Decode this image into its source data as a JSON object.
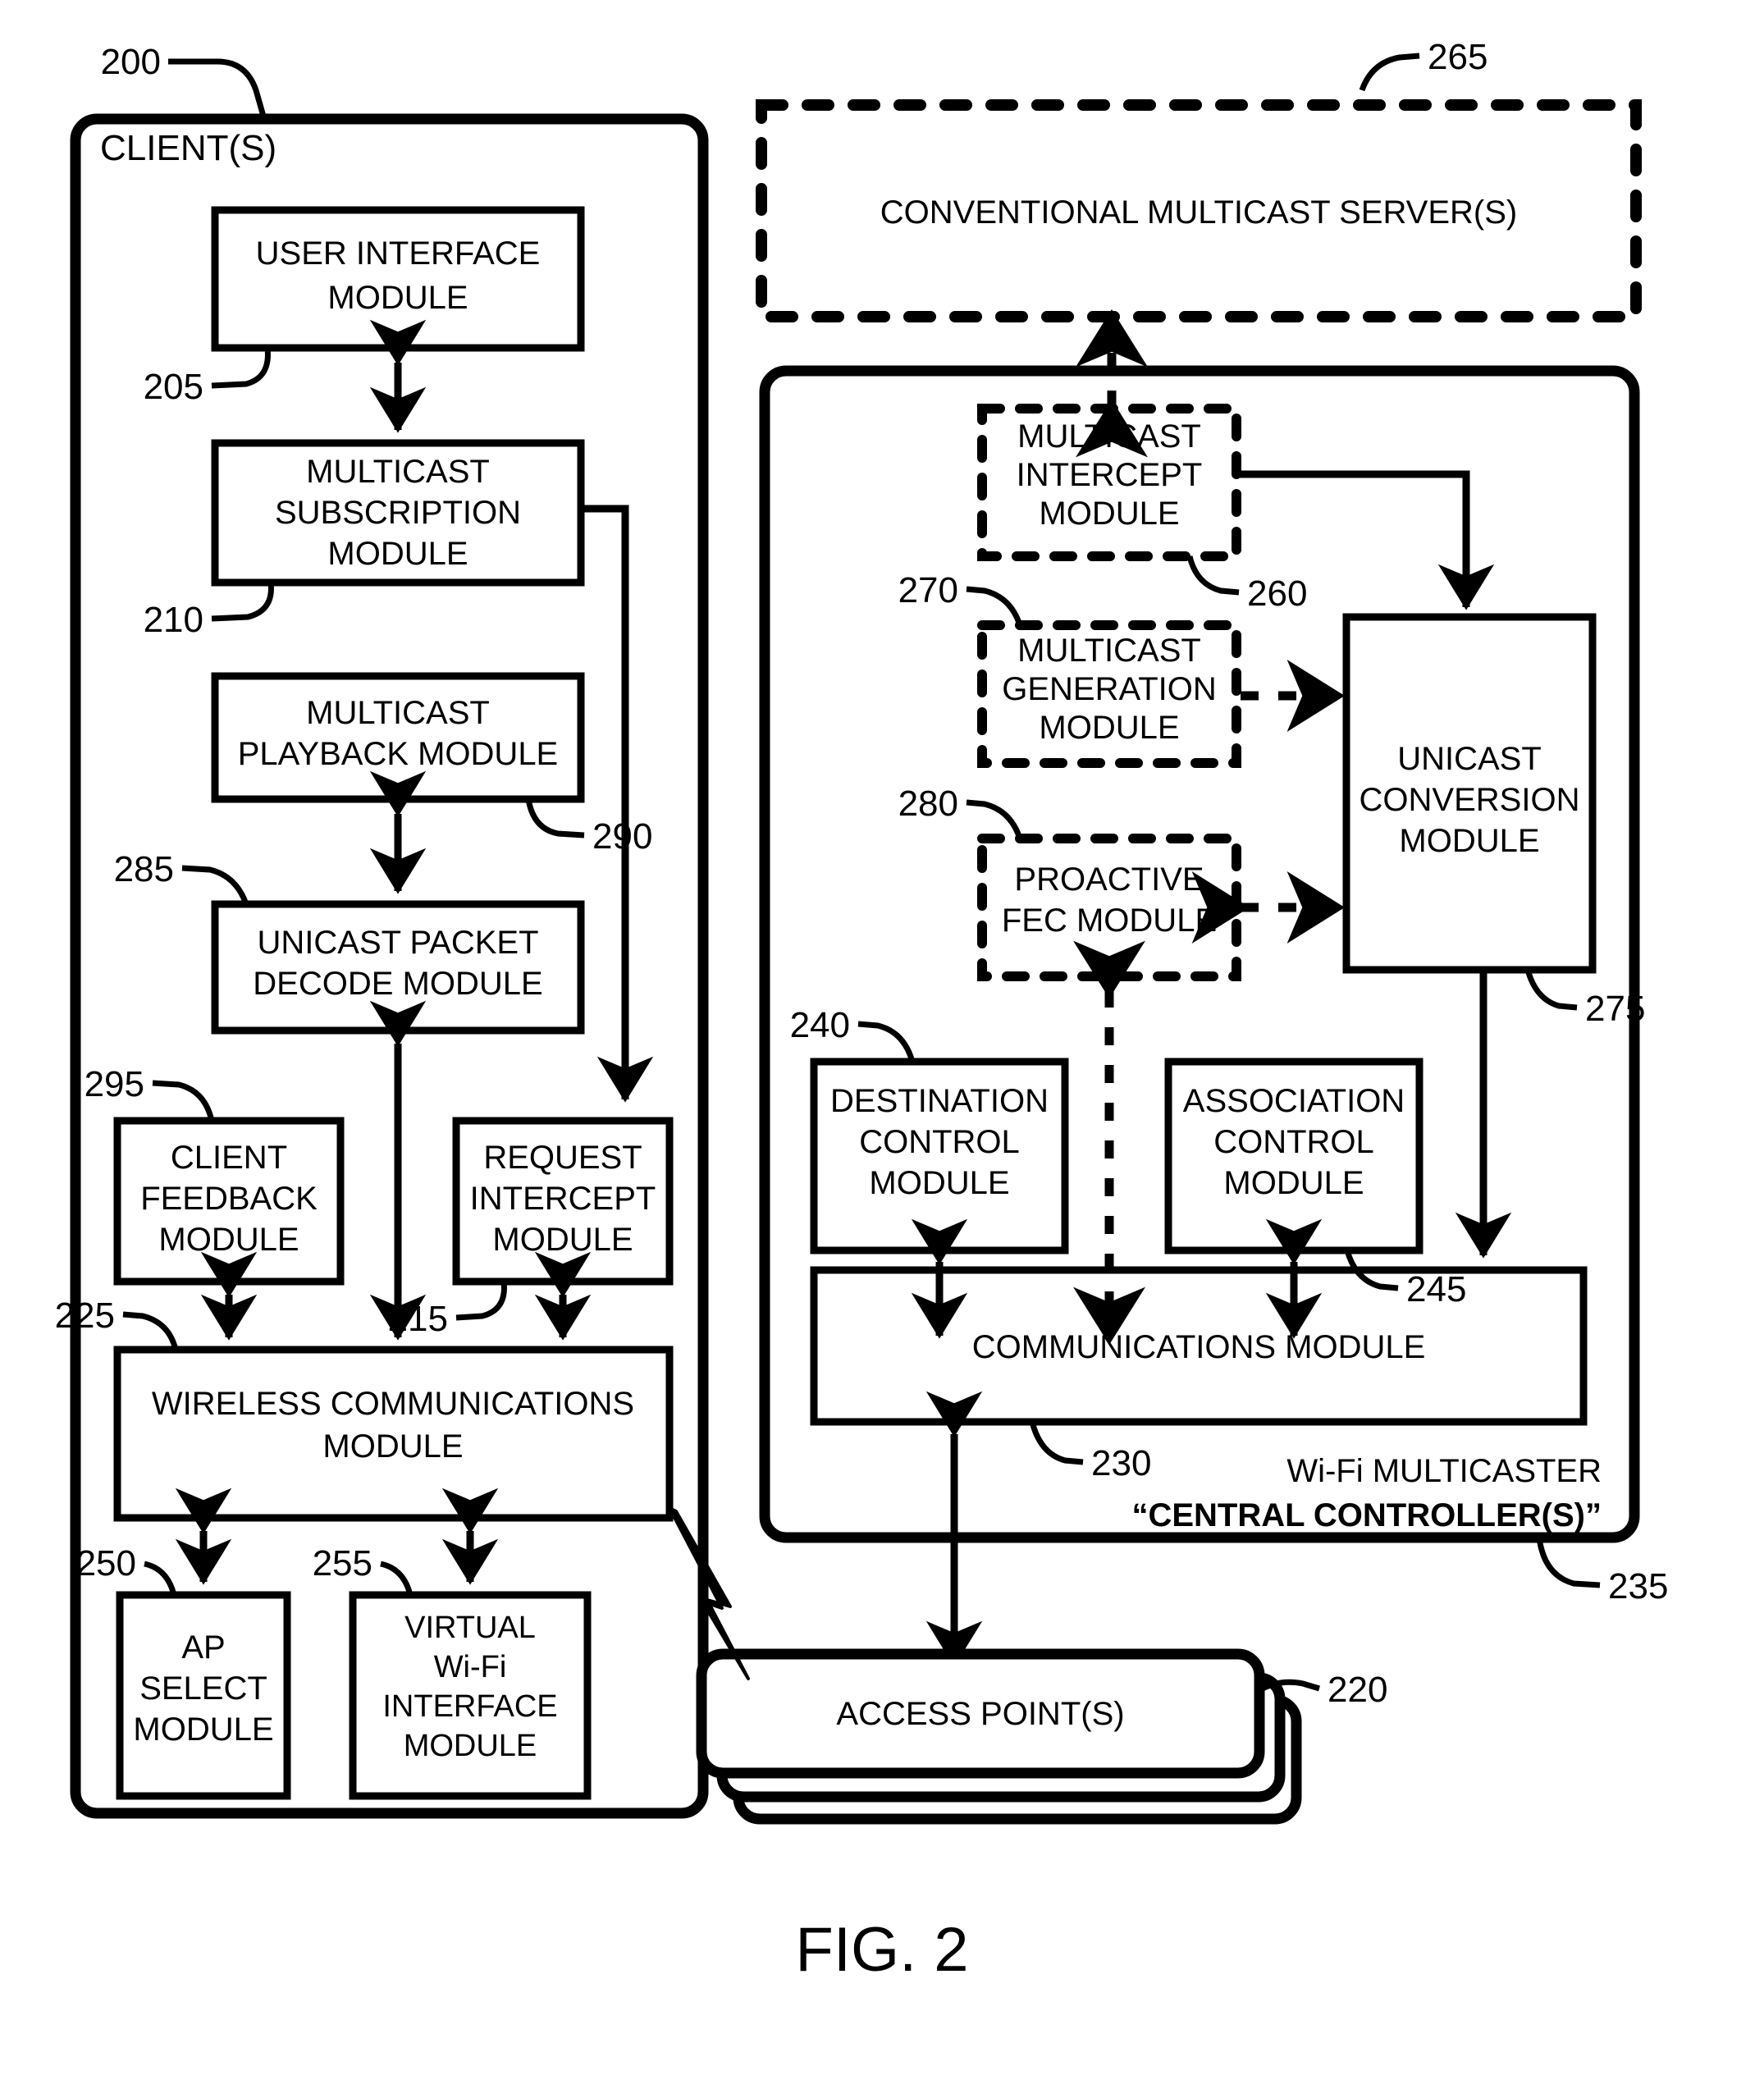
{
  "figure": {
    "caption": "FIG. 2"
  },
  "client_panel": {
    "title": "CLIENT(S)",
    "ref": "200",
    "modules": [
      {
        "id": "user-interface-module",
        "ref": "205",
        "lines": [
          "USER INTERFACE",
          "MODULE"
        ]
      },
      {
        "id": "multicast-subscription-module",
        "ref": "210",
        "lines": [
          "MULTICAST",
          "SUBSCRIPTION",
          "MODULE"
        ]
      },
      {
        "id": "multicast-playback-module",
        "ref": "290",
        "lines": [
          "MULTICAST",
          "PLAYBACK MODULE"
        ]
      },
      {
        "id": "unicast-packet-decode-module",
        "ref": "285",
        "lines": [
          "UNICAST PACKET",
          "DECODE MODULE"
        ]
      },
      {
        "id": "client-feedback-module",
        "ref": "295",
        "lines": [
          "CLIENT",
          "FEEDBACK",
          "MODULE"
        ]
      },
      {
        "id": "request-intercept-module",
        "ref": "215",
        "lines": [
          "REQUEST",
          "INTERCEPT",
          "MODULE"
        ]
      },
      {
        "id": "wireless-communications-module",
        "ref": "225",
        "lines": [
          "WIRELESS COMMUNICATIONS",
          "MODULE"
        ]
      },
      {
        "id": "ap-select-module",
        "ref": "250",
        "lines": [
          "AP",
          "SELECT",
          "MODULE"
        ]
      },
      {
        "id": "virtual-wifi-interface-module",
        "ref": "255",
        "lines": [
          "VIRTUAL",
          "Wi-Fi",
          "INTERFACE",
          "MODULE"
        ]
      }
    ]
  },
  "server_panel": {
    "ref": "265",
    "label": "CONVENTIONAL MULTICAST SERVER(S)"
  },
  "controller_panel": {
    "ref": "235",
    "title_line1": "Wi-Fi MULTICASTER",
    "title_line2": "“CENTRAL CONTROLLER(S)”",
    "modules": [
      {
        "id": "multicast-intercept-module",
        "ref": "260",
        "lines": [
          "MULTICAST",
          "INTERCEPT",
          "MODULE"
        ],
        "style": "dashed"
      },
      {
        "id": "multicast-generation-module",
        "ref": "270",
        "lines": [
          "MULTICAST",
          "GENERATION",
          "MODULE"
        ],
        "style": "dashed"
      },
      {
        "id": "proactive-fec-module",
        "ref": "280",
        "lines": [
          "PROACTIVE",
          "FEC MODULE"
        ],
        "style": "dashed"
      },
      {
        "id": "unicast-conversion-module",
        "ref": "275",
        "lines": [
          "UNICAST",
          "CONVERSION",
          "MODULE"
        ],
        "style": "solid"
      },
      {
        "id": "destination-control-module",
        "ref": "240",
        "lines": [
          "DESTINATION",
          "CONTROL",
          "MODULE"
        ],
        "style": "solid"
      },
      {
        "id": "association-control-module",
        "ref": "245",
        "lines": [
          "ASSOCIATION",
          "CONTROL",
          "MODULE"
        ],
        "style": "solid"
      },
      {
        "id": "communications-module",
        "ref": "230",
        "lines": [
          "COMMUNICATIONS MODULE"
        ],
        "style": "solid"
      }
    ]
  },
  "access_points": {
    "ref": "220",
    "label": "ACCESS POINT(S)"
  },
  "colors": {
    "ink": "#000000",
    "paper": "#ffffff"
  }
}
